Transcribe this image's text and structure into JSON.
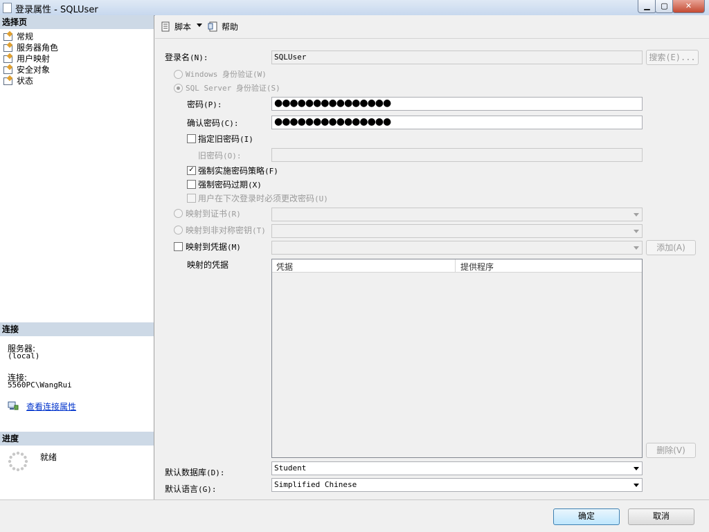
{
  "window": {
    "title": "登录属性 - SQLUser",
    "minimize": "▁",
    "maximize": "▢",
    "close": "✕"
  },
  "left": {
    "select_page_header": "选择页",
    "pages": [
      {
        "label": "常规",
        "icon": "page-icon"
      },
      {
        "label": "服务器角色",
        "icon": "page-icon"
      },
      {
        "label": "用户映射",
        "icon": "page-icon"
      },
      {
        "label": "安全对象",
        "icon": "page-icon"
      },
      {
        "label": "状态",
        "icon": "page-icon"
      }
    ],
    "connection_header": "连接",
    "server_label": "服务器:",
    "server_value": "(local)",
    "connection_label": "连接:",
    "connection_value": "5560PC\\WangRui",
    "view_conn_props": "查看连接属性",
    "progress_header": "进度",
    "progress_status": "就绪"
  },
  "toolbar": {
    "script": "脚本",
    "help": "帮助"
  },
  "form": {
    "login_name_label": "登录名",
    "login_name_acc": "(N):",
    "login_name_value": "SQLUser",
    "search_button": "搜索(E)...",
    "windows_auth": "Windows 身份验证",
    "windows_auth_acc": "(W)",
    "sql_auth": "SQL Server 身份验证",
    "sql_auth_acc": "(S)",
    "password_label": "密码",
    "password_acc": "(P):",
    "password_value": "●●●●●●●●●●●●●●●",
    "confirm_password_label": "确认密码",
    "confirm_password_acc": "(C):",
    "confirm_password_value": "●●●●●●●●●●●●●●●",
    "specify_old_password": "指定旧密码",
    "specify_old_password_acc": "(I)",
    "old_password_label": "旧密码",
    "old_password_acc": "(O):",
    "enforce_policy": "强制实施密码策略",
    "enforce_policy_acc": "(F)",
    "enforce_expiration": "强制密码过期",
    "enforce_expiration_acc": "(X)",
    "must_change": "用户在下次登录时必须更改密码",
    "must_change_acc": "(U)",
    "map_cert": "映射到证书",
    "map_cert_acc": "(R)",
    "map_asym_key": "映射到非对称密钥",
    "map_asym_key_acc": "(T)",
    "map_credential": "映射到凭据",
    "map_credential_acc": "(M)",
    "add_button": "添加(A)",
    "mapped_credentials_label": "映射的凭据",
    "grid_col_credential": "凭据",
    "grid_col_provider": "提供程序",
    "remove_button": "删除(V)",
    "default_db_label": "默认数据库",
    "default_db_acc": "(D):",
    "default_db_value": "Student",
    "default_lang_label": "默认语言",
    "default_lang_acc": "(G):",
    "default_lang_value": "Simplified Chinese"
  },
  "states": {
    "enforce_policy_checked": true,
    "enforce_expiration_checked": false,
    "specify_old_password_checked": false,
    "must_change_checked": false,
    "map_credential_checked": false,
    "selected_auth": "sql"
  },
  "buttons": {
    "ok": "确定",
    "cancel": "取消"
  },
  "colors": {
    "section_header": "#cdd9e6",
    "link": "#0033cc",
    "disabled_text": "#9a9a9a"
  }
}
